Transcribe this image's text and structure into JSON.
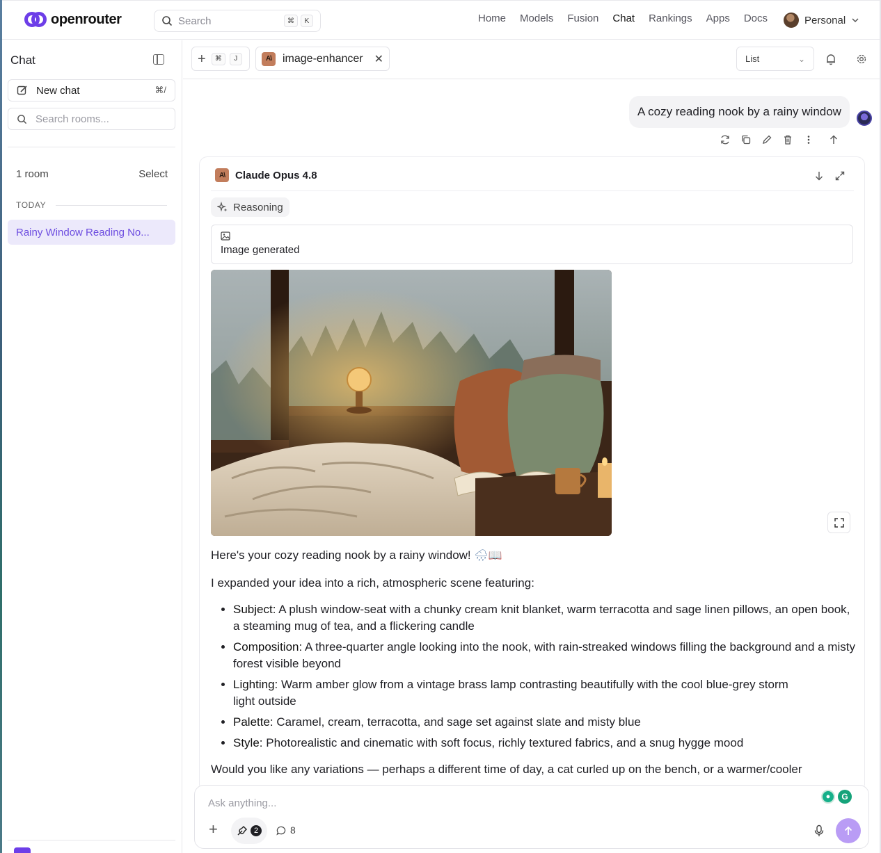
{
  "header": {
    "brand": "openrouter",
    "search_placeholder": "Search",
    "search_shortcut": [
      "⌘",
      "K"
    ],
    "nav": [
      "Home",
      "Models",
      "Fusion",
      "Chat",
      "Rankings",
      "Apps",
      "Docs"
    ],
    "active_nav": "Chat",
    "account_label": "Personal"
  },
  "sidebar": {
    "title": "Chat",
    "new_chat_label": "New chat",
    "new_chat_shortcut": "⌘/",
    "search_placeholder": "Search rooms...",
    "room_count": "1 room",
    "select_label": "Select",
    "section_today": "TODAY",
    "rooms": [
      "Rainy Window Reading No..."
    ]
  },
  "chat_header": {
    "shortcut": [
      "⌘",
      "J"
    ],
    "tab_label": "image-enhancer",
    "view_select_value": "List"
  },
  "conversation": {
    "user_message": "A cozy reading nook by a rainy window",
    "model_name": "Claude Opus 4.8",
    "reasoning_label": "Reasoning",
    "image_status": "Image generated",
    "intro": "Here's your cozy reading nook by a rainy window!",
    "intro_emoji": "🌧📖",
    "lead": "I expanded your idea into a rich, atmospheric scene featuring:",
    "features": [
      {
        "label": "Subject:",
        "text": "A plush window-seat with a chunky cream knit blanket, warm terracotta and sage linen pillows, an open book, a steaming mug of tea, and a flickering candle"
      },
      {
        "label": "Composition:",
        "text": "A three-quarter angle looking into the nook, with rain-streaked windows filling the background and a misty forest visible beyond"
      },
      {
        "label": "Lighting:",
        "text": "Warm amber glow from a vintage brass lamp contrasting beautifully with the cool blue-grey storm light outside"
      },
      {
        "label": "Palette:",
        "text": "Caramel, cream, terracotta, and sage set against slate and misty blue"
      },
      {
        "label": "Style:",
        "text": "Photorealistic and cinematic with soft focus, richly textured fabrics, and a snug hygge mood"
      }
    ],
    "closing": "Would you like any variations — perhaps a different time of day, a cat curled up on the bench, or a warmer/cooler"
  },
  "composer": {
    "placeholder": "Ask anything...",
    "tools_count": "2",
    "message_count": "8"
  },
  "colors": {
    "brand": "#6d3ee8",
    "active_room_bg": "#ece9fb",
    "active_room_text": "#6d4de0",
    "send_button": "#b99cf5",
    "anthropic_badge": "#c27d5c"
  },
  "icons": [
    "search-icon",
    "sidebar-toggle-icon",
    "edit-icon",
    "plus-icon",
    "anthropic-icon",
    "close-icon",
    "chevron-down-icon",
    "bell-icon",
    "gear-icon",
    "refresh-icon",
    "copy-icon",
    "pencil-icon",
    "trash-icon",
    "more-icon",
    "arrow-up-icon",
    "arrow-down-icon",
    "expand-icon",
    "sparkle-icon",
    "image-icon",
    "fullscreen-icon",
    "tools-icon",
    "message-icon",
    "mic-icon",
    "send-icon"
  ]
}
